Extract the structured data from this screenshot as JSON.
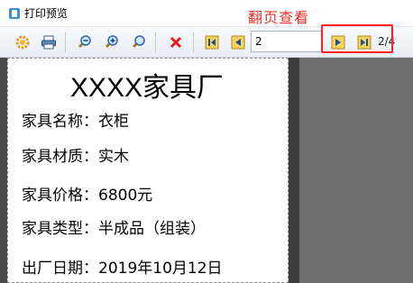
{
  "window": {
    "title": "打印预览"
  },
  "annotation": "翻页查看",
  "toolbar": {
    "buttons": [
      {
        "name": "settings-button",
        "icon": "gear-icon"
      },
      {
        "name": "print-button",
        "icon": "printer-icon"
      },
      {
        "name": "zoom-out-button",
        "icon": "zoom-out-icon"
      },
      {
        "name": "zoom-in-button",
        "icon": "zoom-in-icon"
      },
      {
        "name": "zoom-fit-button",
        "icon": "zoom-fit-icon"
      },
      {
        "name": "close-button",
        "icon": "close-icon"
      },
      {
        "name": "first-page-button",
        "icon": "first-page-icon"
      },
      {
        "name": "prev-page-button",
        "icon": "prev-page-icon"
      },
      {
        "name": "next-page-button",
        "icon": "next-page-icon"
      },
      {
        "name": "last-page-button",
        "icon": "last-page-icon"
      }
    ],
    "current_page": "2",
    "page_total": "2/4"
  },
  "document": {
    "heading": "XXXX家具厂",
    "fields": [
      "家具名称：衣柜",
      "家具材质：实木",
      "家具价格：6800元",
      "家具类型：半成品（组装）",
      "出厂日期：2019年10月12日"
    ]
  },
  "colors": {
    "annotation": "#e8312c",
    "highlight": "#ff1f1f",
    "viewer_background": "#6e6e6e"
  }
}
